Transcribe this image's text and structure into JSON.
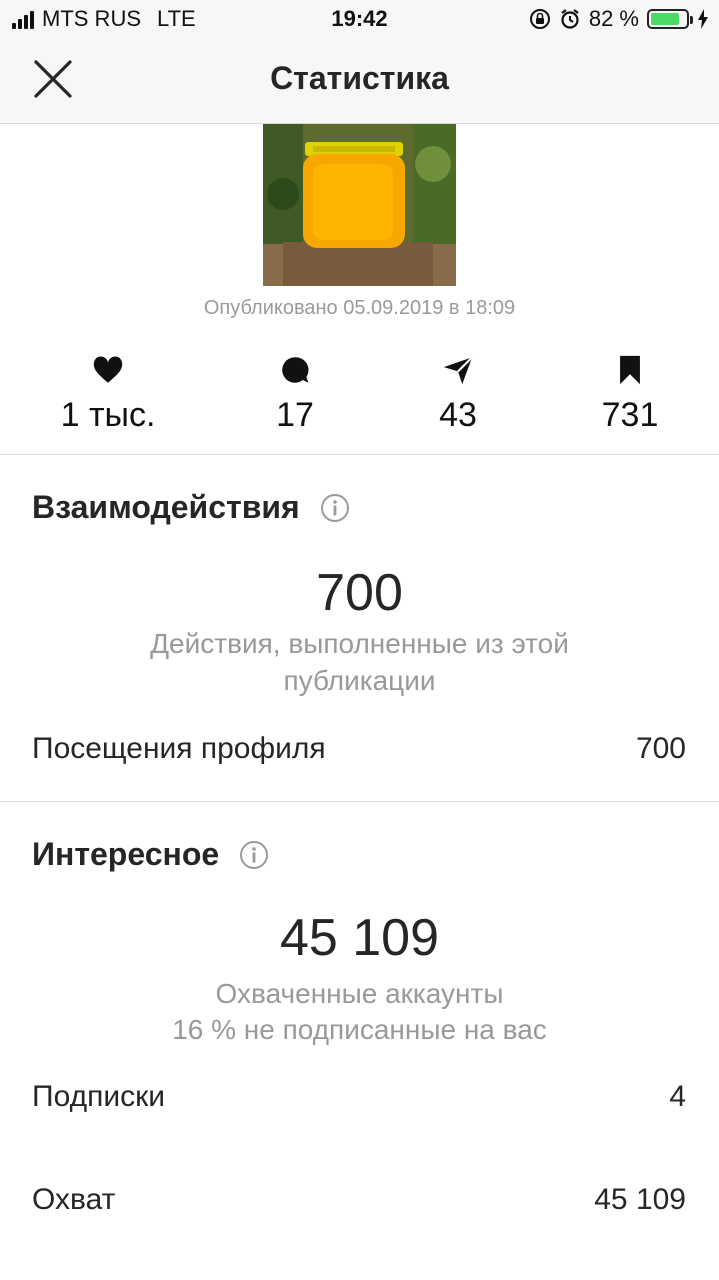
{
  "status_bar": {
    "carrier": "MTS RUS",
    "network": "LTE",
    "time": "19:42",
    "battery_percent": "82 %",
    "battery_level": 0.82,
    "battery_color": "#4cd964"
  },
  "header": {
    "title": "Статистика",
    "close_icon": "close-icon"
  },
  "post": {
    "published": "Опубликовано 05.09.2019 в 18:09"
  },
  "stats": [
    {
      "icon": "heart-icon",
      "value": "1 тыс."
    },
    {
      "icon": "comment-icon",
      "value": "17"
    },
    {
      "icon": "share-icon",
      "value": "43"
    },
    {
      "icon": "bookmark-icon",
      "value": "731"
    }
  ],
  "interactions": {
    "title": "Взаимодействия",
    "value": "700",
    "description": "Действия, выполненные из этой публикации",
    "rows": [
      {
        "label": "Посещения профиля",
        "value": "700"
      }
    ]
  },
  "discovery": {
    "title": "Интересное",
    "value": "45 109",
    "description": "Охваченные аккаунты",
    "note": "16 % не подписанные на вас",
    "rows": [
      {
        "label": "Подписки",
        "value": "4"
      },
      {
        "label": "Охват",
        "value": "45 109"
      }
    ]
  }
}
